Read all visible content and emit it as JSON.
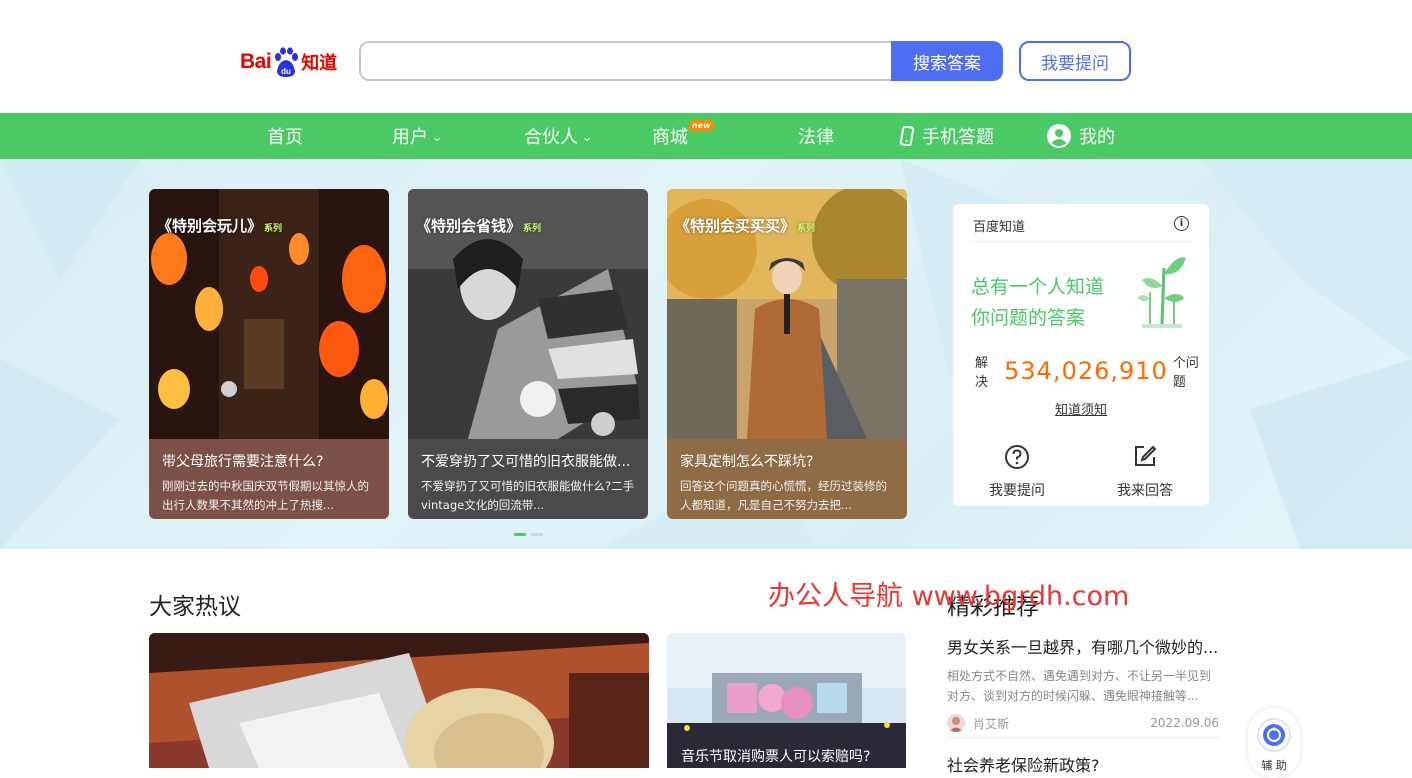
{
  "header": {
    "logo_bai": "Bai",
    "logo_du": "du",
    "logo_zhidao": "知道",
    "search_placeholder": "",
    "search_button": "搜索答案",
    "ask_button": "我要提问"
  },
  "nav": {
    "home": "首页",
    "users": "用户",
    "partners": "合伙人",
    "mall": "商城",
    "mall_badge": "new",
    "law": "法律",
    "mobile": "手机答题",
    "mine": "我的"
  },
  "cards": [
    {
      "series": "《特别会玩儿》",
      "series_suffix": "系列",
      "title": "带父母旅行需要注意什么?",
      "desc": "刚刚过去的中秋国庆双节假期以其惊人的出行人数果不其然的冲上了热搜..."
    },
    {
      "series": "《特别会省钱》",
      "series_suffix": "系列",
      "title": "不爱穿扔了又可惜的旧衣服能做...",
      "desc": "不爱穿扔了又可惜的旧衣服能做什么?二手vintage文化的回流带..."
    },
    {
      "series": "《特别会买买买》",
      "series_suffix": "系列",
      "title": "家具定制怎么不踩坑?",
      "desc": "回答这个问题真的心慌慌，经历过装修的人都知道，凡是自己不努力去把..."
    }
  ],
  "panel": {
    "title": "百度知道",
    "info_icon": "i",
    "slogan_line1": "总有一个人知道",
    "slogan_line2": "你问题的答案",
    "solved_prefix": "解决",
    "solved_count": "534,026,910",
    "solved_suffix": "个问题",
    "notice": "知道须知",
    "ask": "我要提问",
    "answer": "我来回答"
  },
  "hot": {
    "title": "大家热议",
    "small_caption": "音乐节取消购票人可以索赔吗?"
  },
  "recommend": {
    "title": "精彩推荐",
    "items": [
      {
        "title": "男女关系一旦越界，有哪几个微妙的...",
        "desc": "相处方式不自然、遇免遇到对方、不让另一半见到对方、谈到对方的时候闪躲、遇免眼神接触等...",
        "author": "肖艾斯",
        "date": "2022.09.06"
      },
      {
        "title": "社会养老保险新政策?"
      }
    ]
  },
  "watermark": "办公人导航 www.bgrdh.com",
  "assist_label": "辅 助",
  "colors": {
    "brand_green": "#4ac964",
    "brand_blue": "#4e6ef2",
    "logo_red": "#e10602",
    "count_orange": "#ff6a00"
  }
}
